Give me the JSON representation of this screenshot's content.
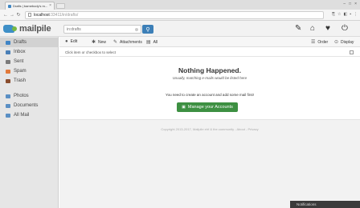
{
  "browser": {
    "tab_title": "Drafts | bamebody's m...",
    "url_host": "localhost",
    "url_path": ":33411/in/drafts/"
  },
  "app": {
    "logo_text": "mailpile",
    "search_placeholder": "in:drafts"
  },
  "sidebar": {
    "items": [
      {
        "label": "Drafts",
        "icon": "drafts-icon",
        "color": "#3f84c5"
      },
      {
        "label": "Inbox",
        "icon": "inbox-icon",
        "color": "#4a7fb7"
      },
      {
        "label": "Sent",
        "icon": "sent-icon",
        "color": "#7a7a7a"
      },
      {
        "label": "Spam",
        "icon": "spam-icon",
        "color": "#e1793a"
      },
      {
        "label": "Trash",
        "icon": "trash-icon",
        "color": "#8a4d2e"
      },
      {
        "label": "Photos",
        "icon": "photos-icon",
        "color": "#5a8fc4"
      },
      {
        "label": "Documents",
        "icon": "documents-icon",
        "color": "#5a8fc4"
      },
      {
        "label": "All Mail",
        "icon": "all-mail-icon",
        "color": "#5a8fc4"
      }
    ]
  },
  "actions": {
    "edit": "Edit",
    "new": "New",
    "attachments": "Attachments",
    "all": "All",
    "order": "Order",
    "display": "Display"
  },
  "select_hint": "Click item or checkbox to select",
  "empty": {
    "title": "Nothing Happened.",
    "subtitle": "Usually, matching e-mails would be listed here",
    "text": "You need to create an account and add some mail first!",
    "button": "Manage your Accounts"
  },
  "footer": "Copyright 2013-2017, Mailpile ehf & the community - About - Privacy",
  "notifications": "Notifications",
  "colors": {
    "accent": "#3c7fb7",
    "button_green": "#3d9042"
  }
}
